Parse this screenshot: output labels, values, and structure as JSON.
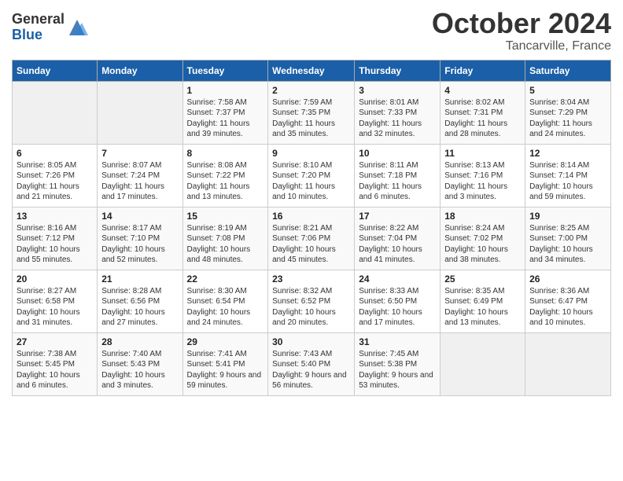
{
  "logo": {
    "general": "General",
    "blue": "Blue"
  },
  "title": "October 2024",
  "location": "Tancarville, France",
  "days_header": [
    "Sunday",
    "Monday",
    "Tuesday",
    "Wednesday",
    "Thursday",
    "Friday",
    "Saturday"
  ],
  "weeks": [
    [
      {
        "day": "",
        "info": ""
      },
      {
        "day": "",
        "info": ""
      },
      {
        "day": "1",
        "info": "Sunrise: 7:58 AM\nSunset: 7:37 PM\nDaylight: 11 hours and 39 minutes."
      },
      {
        "day": "2",
        "info": "Sunrise: 7:59 AM\nSunset: 7:35 PM\nDaylight: 11 hours and 35 minutes."
      },
      {
        "day": "3",
        "info": "Sunrise: 8:01 AM\nSunset: 7:33 PM\nDaylight: 11 hours and 32 minutes."
      },
      {
        "day": "4",
        "info": "Sunrise: 8:02 AM\nSunset: 7:31 PM\nDaylight: 11 hours and 28 minutes."
      },
      {
        "day": "5",
        "info": "Sunrise: 8:04 AM\nSunset: 7:29 PM\nDaylight: 11 hours and 24 minutes."
      }
    ],
    [
      {
        "day": "6",
        "info": "Sunrise: 8:05 AM\nSunset: 7:26 PM\nDaylight: 11 hours and 21 minutes."
      },
      {
        "day": "7",
        "info": "Sunrise: 8:07 AM\nSunset: 7:24 PM\nDaylight: 11 hours and 17 minutes."
      },
      {
        "day": "8",
        "info": "Sunrise: 8:08 AM\nSunset: 7:22 PM\nDaylight: 11 hours and 13 minutes."
      },
      {
        "day": "9",
        "info": "Sunrise: 8:10 AM\nSunset: 7:20 PM\nDaylight: 11 hours and 10 minutes."
      },
      {
        "day": "10",
        "info": "Sunrise: 8:11 AM\nSunset: 7:18 PM\nDaylight: 11 hours and 6 minutes."
      },
      {
        "day": "11",
        "info": "Sunrise: 8:13 AM\nSunset: 7:16 PM\nDaylight: 11 hours and 3 minutes."
      },
      {
        "day": "12",
        "info": "Sunrise: 8:14 AM\nSunset: 7:14 PM\nDaylight: 10 hours and 59 minutes."
      }
    ],
    [
      {
        "day": "13",
        "info": "Sunrise: 8:16 AM\nSunset: 7:12 PM\nDaylight: 10 hours and 55 minutes."
      },
      {
        "day": "14",
        "info": "Sunrise: 8:17 AM\nSunset: 7:10 PM\nDaylight: 10 hours and 52 minutes."
      },
      {
        "day": "15",
        "info": "Sunrise: 8:19 AM\nSunset: 7:08 PM\nDaylight: 10 hours and 48 minutes."
      },
      {
        "day": "16",
        "info": "Sunrise: 8:21 AM\nSunset: 7:06 PM\nDaylight: 10 hours and 45 minutes."
      },
      {
        "day": "17",
        "info": "Sunrise: 8:22 AM\nSunset: 7:04 PM\nDaylight: 10 hours and 41 minutes."
      },
      {
        "day": "18",
        "info": "Sunrise: 8:24 AM\nSunset: 7:02 PM\nDaylight: 10 hours and 38 minutes."
      },
      {
        "day": "19",
        "info": "Sunrise: 8:25 AM\nSunset: 7:00 PM\nDaylight: 10 hours and 34 minutes."
      }
    ],
    [
      {
        "day": "20",
        "info": "Sunrise: 8:27 AM\nSunset: 6:58 PM\nDaylight: 10 hours and 31 minutes."
      },
      {
        "day": "21",
        "info": "Sunrise: 8:28 AM\nSunset: 6:56 PM\nDaylight: 10 hours and 27 minutes."
      },
      {
        "day": "22",
        "info": "Sunrise: 8:30 AM\nSunset: 6:54 PM\nDaylight: 10 hours and 24 minutes."
      },
      {
        "day": "23",
        "info": "Sunrise: 8:32 AM\nSunset: 6:52 PM\nDaylight: 10 hours and 20 minutes."
      },
      {
        "day": "24",
        "info": "Sunrise: 8:33 AM\nSunset: 6:50 PM\nDaylight: 10 hours and 17 minutes."
      },
      {
        "day": "25",
        "info": "Sunrise: 8:35 AM\nSunset: 6:49 PM\nDaylight: 10 hours and 13 minutes."
      },
      {
        "day": "26",
        "info": "Sunrise: 8:36 AM\nSunset: 6:47 PM\nDaylight: 10 hours and 10 minutes."
      }
    ],
    [
      {
        "day": "27",
        "info": "Sunrise: 7:38 AM\nSunset: 5:45 PM\nDaylight: 10 hours and 6 minutes."
      },
      {
        "day": "28",
        "info": "Sunrise: 7:40 AM\nSunset: 5:43 PM\nDaylight: 10 hours and 3 minutes."
      },
      {
        "day": "29",
        "info": "Sunrise: 7:41 AM\nSunset: 5:41 PM\nDaylight: 9 hours and 59 minutes."
      },
      {
        "day": "30",
        "info": "Sunrise: 7:43 AM\nSunset: 5:40 PM\nDaylight: 9 hours and 56 minutes."
      },
      {
        "day": "31",
        "info": "Sunrise: 7:45 AM\nSunset: 5:38 PM\nDaylight: 9 hours and 53 minutes."
      },
      {
        "day": "",
        "info": ""
      },
      {
        "day": "",
        "info": ""
      }
    ]
  ]
}
